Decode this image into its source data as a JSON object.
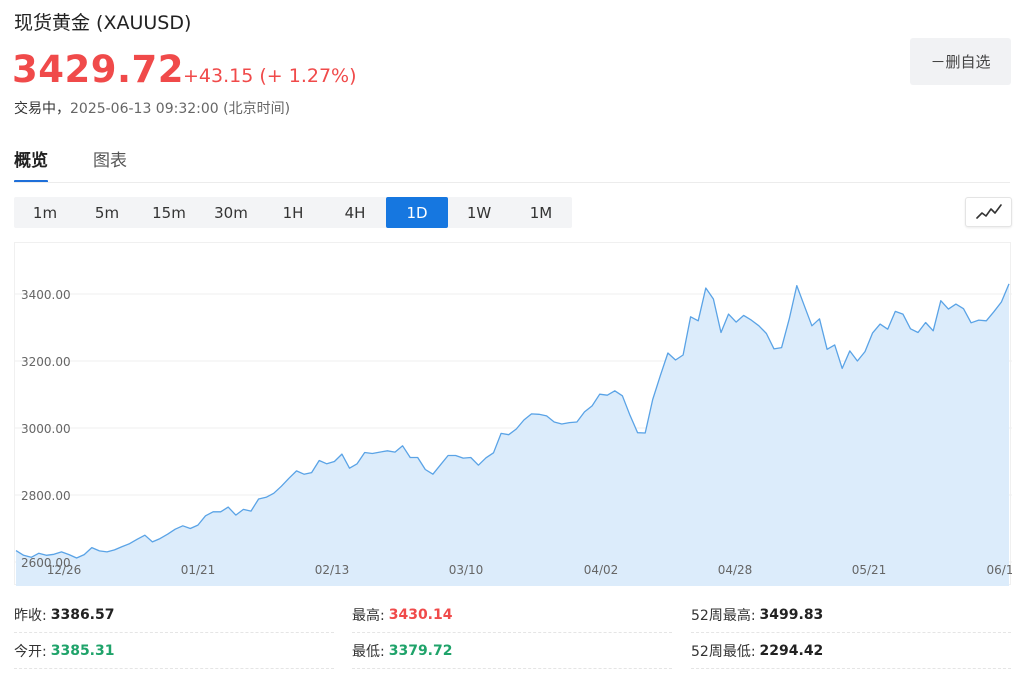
{
  "header": {
    "title": "现货黄金  (XAUUSD)",
    "price": "3429.72",
    "change": "+43.15 (+ 1.27%)",
    "status": "交易中，",
    "time": "2025-06-13 09:32:00 (北京时间)"
  },
  "watchlist_button": "－删自选",
  "tabs": [
    {
      "label": "概览",
      "active": true
    },
    {
      "label": "图表",
      "active": false
    }
  ],
  "periods": [
    {
      "label": "1m",
      "active": false
    },
    {
      "label": "5m",
      "active": false
    },
    {
      "label": "15m",
      "active": false
    },
    {
      "label": "30m",
      "active": false
    },
    {
      "label": "1H",
      "active": false
    },
    {
      "label": "4H",
      "active": false
    },
    {
      "label": "1D",
      "active": true
    },
    {
      "label": "1W",
      "active": false
    },
    {
      "label": "1M",
      "active": false
    }
  ],
  "chart_type_icon": "line-chart-icon",
  "colors": {
    "up": "#f04a4a",
    "down": "#1fa36a",
    "accent": "#1677e0",
    "line": "#5aa3e6",
    "fill": "#dcecfb"
  },
  "chart_data": {
    "type": "area",
    "ylim": [
      2600,
      3500
    ],
    "y_ticks": [
      2600,
      2800,
      3000,
      3200,
      3400
    ],
    "y_tick_labels": [
      "2600.00",
      "2800.00",
      "3000.00",
      "3200.00",
      "3400.00"
    ],
    "x_tick_labels": [
      "12/26",
      "01/21",
      "02/13",
      "03/10",
      "04/02",
      "04/28",
      "05/21",
      "06/1"
    ],
    "grid": true,
    "values": [
      2634,
      2620,
      2614,
      2626,
      2620,
      2623,
      2630,
      2622,
      2612,
      2622,
      2643,
      2633,
      2630,
      2636,
      2646,
      2655,
      2668,
      2680,
      2660,
      2670,
      2683,
      2698,
      2708,
      2700,
      2710,
      2738,
      2750,
      2750,
      2764,
      2740,
      2757,
      2752,
      2788,
      2793,
      2805,
      2826,
      2850,
      2872,
      2862,
      2867,
      2903,
      2893,
      2900,
      2922,
      2880,
      2893,
      2927,
      2924,
      2928,
      2932,
      2928,
      2947,
      2912,
      2912,
      2876,
      2862,
      2890,
      2918,
      2918,
      2910,
      2912,
      2889,
      2911,
      2926,
      2984,
      2980,
      2997,
      3024,
      3042,
      3041,
      3036,
      3018,
      3012,
      3016,
      3018,
      3048,
      3066,
      3101,
      3098,
      3111,
      3096,
      3038,
      2986,
      2985,
      3085,
      3156,
      3224,
      3203,
      3218,
      3332,
      3320,
      3418,
      3385,
      3285,
      3340,
      3316,
      3336,
      3322,
      3305,
      3282,
      3236,
      3240,
      3325,
      3425,
      3365,
      3305,
      3326,
      3235,
      3248,
      3178,
      3230,
      3200,
      3228,
      3284,
      3310,
      3295,
      3348,
      3340,
      3296,
      3285,
      3315,
      3290,
      3380,
      3355,
      3370,
      3356,
      3314,
      3322,
      3320,
      3347,
      3376,
      3430
    ]
  },
  "stats": [
    {
      "label": "昨收:",
      "value": "3386.57",
      "tone": "neutral"
    },
    {
      "label": "最高:",
      "value": "3430.14",
      "tone": "up"
    },
    {
      "label": "52周最高:",
      "value": "3499.83",
      "tone": "neutral"
    },
    {
      "label": "今开:",
      "value": "3385.31",
      "tone": "down"
    },
    {
      "label": "最低:",
      "value": "3379.72",
      "tone": "down"
    },
    {
      "label": "52周最低:",
      "value": "2294.42",
      "tone": "neutral"
    }
  ]
}
